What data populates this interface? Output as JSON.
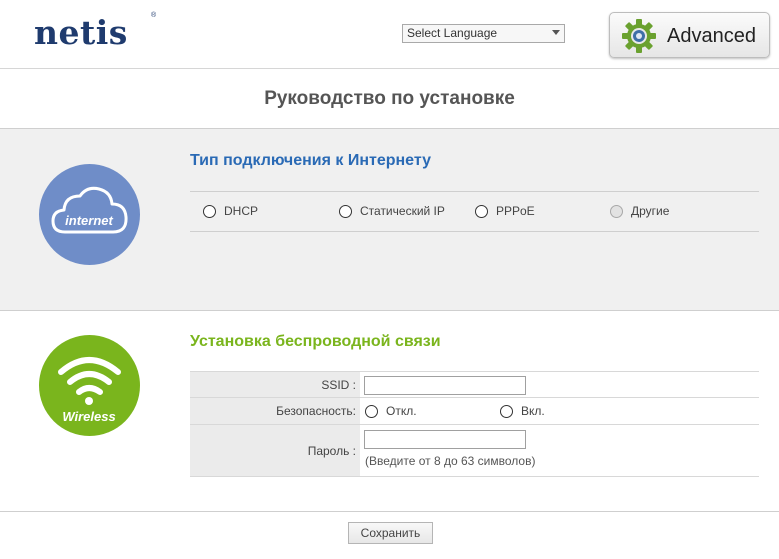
{
  "header": {
    "logo_text": "netis",
    "logo_mark": "®",
    "language_select": {
      "selected": "Select Language"
    },
    "advanced_button": {
      "label": "Advanced",
      "icon": "gear-icon"
    }
  },
  "page": {
    "title": "Руководство по установке"
  },
  "internet": {
    "icon_label": "internet",
    "section_title": "Тип подключения к Интернету",
    "options": [
      {
        "label": "DHCP",
        "selected": false,
        "enabled": true
      },
      {
        "label": "Статический IP",
        "selected": false,
        "enabled": true
      },
      {
        "label": "PPPoE",
        "selected": false,
        "enabled": true
      },
      {
        "label": "Другие",
        "selected": false,
        "enabled": false
      }
    ]
  },
  "wireless": {
    "icon_label": "Wireless",
    "section_title": "Установка беспроводной связи",
    "ssid_label": "SSID :",
    "ssid_value": "",
    "security_label": "Безопасность:",
    "security_options": [
      {
        "label": "Откл.",
        "selected": false
      },
      {
        "label": "Вкл.",
        "selected": false
      }
    ],
    "password_label": "Пароль :",
    "password_value": "",
    "password_hint": "(Введите от 8 до 63 символов)"
  },
  "footer": {
    "save_label": "Сохранить"
  },
  "colors": {
    "brand_blue": "#1f3b6e",
    "internet_circle": "#6f8dc8",
    "internet_title": "#2a6ab5",
    "wireless_green": "#7ab51d",
    "gear_green": "#6aa12f"
  }
}
